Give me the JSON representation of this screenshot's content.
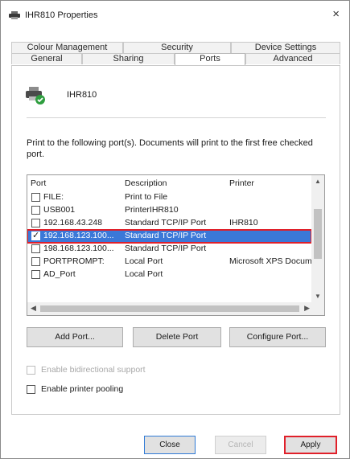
{
  "window": {
    "title": "IHR810 Properties",
    "close_glyph": "×"
  },
  "tabs": {
    "row1": [
      "Colour Management",
      "Security",
      "Device Settings"
    ],
    "row2": [
      "General",
      "Sharing",
      "Ports",
      "Advanced"
    ],
    "active": "Ports"
  },
  "printer": {
    "name": "IHR810",
    "icon": "printer-shared-icon"
  },
  "instruction": "Print to the following port(s). Documents will print to the first free checked port.",
  "port_list": {
    "headers": [
      "Port",
      "Description",
      "Printer"
    ],
    "rows": [
      {
        "port": "FILE:",
        "description": "Print to File",
        "printer": "",
        "checked": false,
        "selected": false
      },
      {
        "port": "USB001",
        "description": "PrinterIHR810",
        "printer": "",
        "checked": false,
        "selected": false
      },
      {
        "port": "192.168.43.248",
        "description": "Standard TCP/IP Port",
        "printer": "IHR810",
        "checked": false,
        "selected": false
      },
      {
        "port": "192.168.123.100...",
        "description": "Standard TCP/IP Port",
        "printer": "",
        "checked": true,
        "selected": true
      },
      {
        "port": "198.168.123.100...",
        "description": "Standard TCP/IP Port",
        "printer": "",
        "checked": false,
        "selected": false
      },
      {
        "port": "PORTPROMPT:",
        "description": "Local Port",
        "printer": "Microsoft XPS Docum",
        "checked": false,
        "selected": false
      },
      {
        "port": "AD_Port",
        "description": "Local Port",
        "printer": "",
        "checked": false,
        "selected": false
      }
    ]
  },
  "buttons": {
    "add_port": "Add Port...",
    "delete_port": "Delete Port",
    "configure_port": "Configure Port..."
  },
  "options": {
    "bidirectional": {
      "label": "Enable bidirectional support",
      "checked": false,
      "enabled": false
    },
    "pooling": {
      "label": "Enable printer pooling",
      "checked": false,
      "enabled": true
    }
  },
  "dialog_buttons": {
    "close": "Close",
    "cancel": "Cancel",
    "apply": "Apply"
  },
  "colors": {
    "selection": "#3b78d8",
    "highlight_outline": "#e0202a",
    "focus_border": "#2f7ad6"
  }
}
